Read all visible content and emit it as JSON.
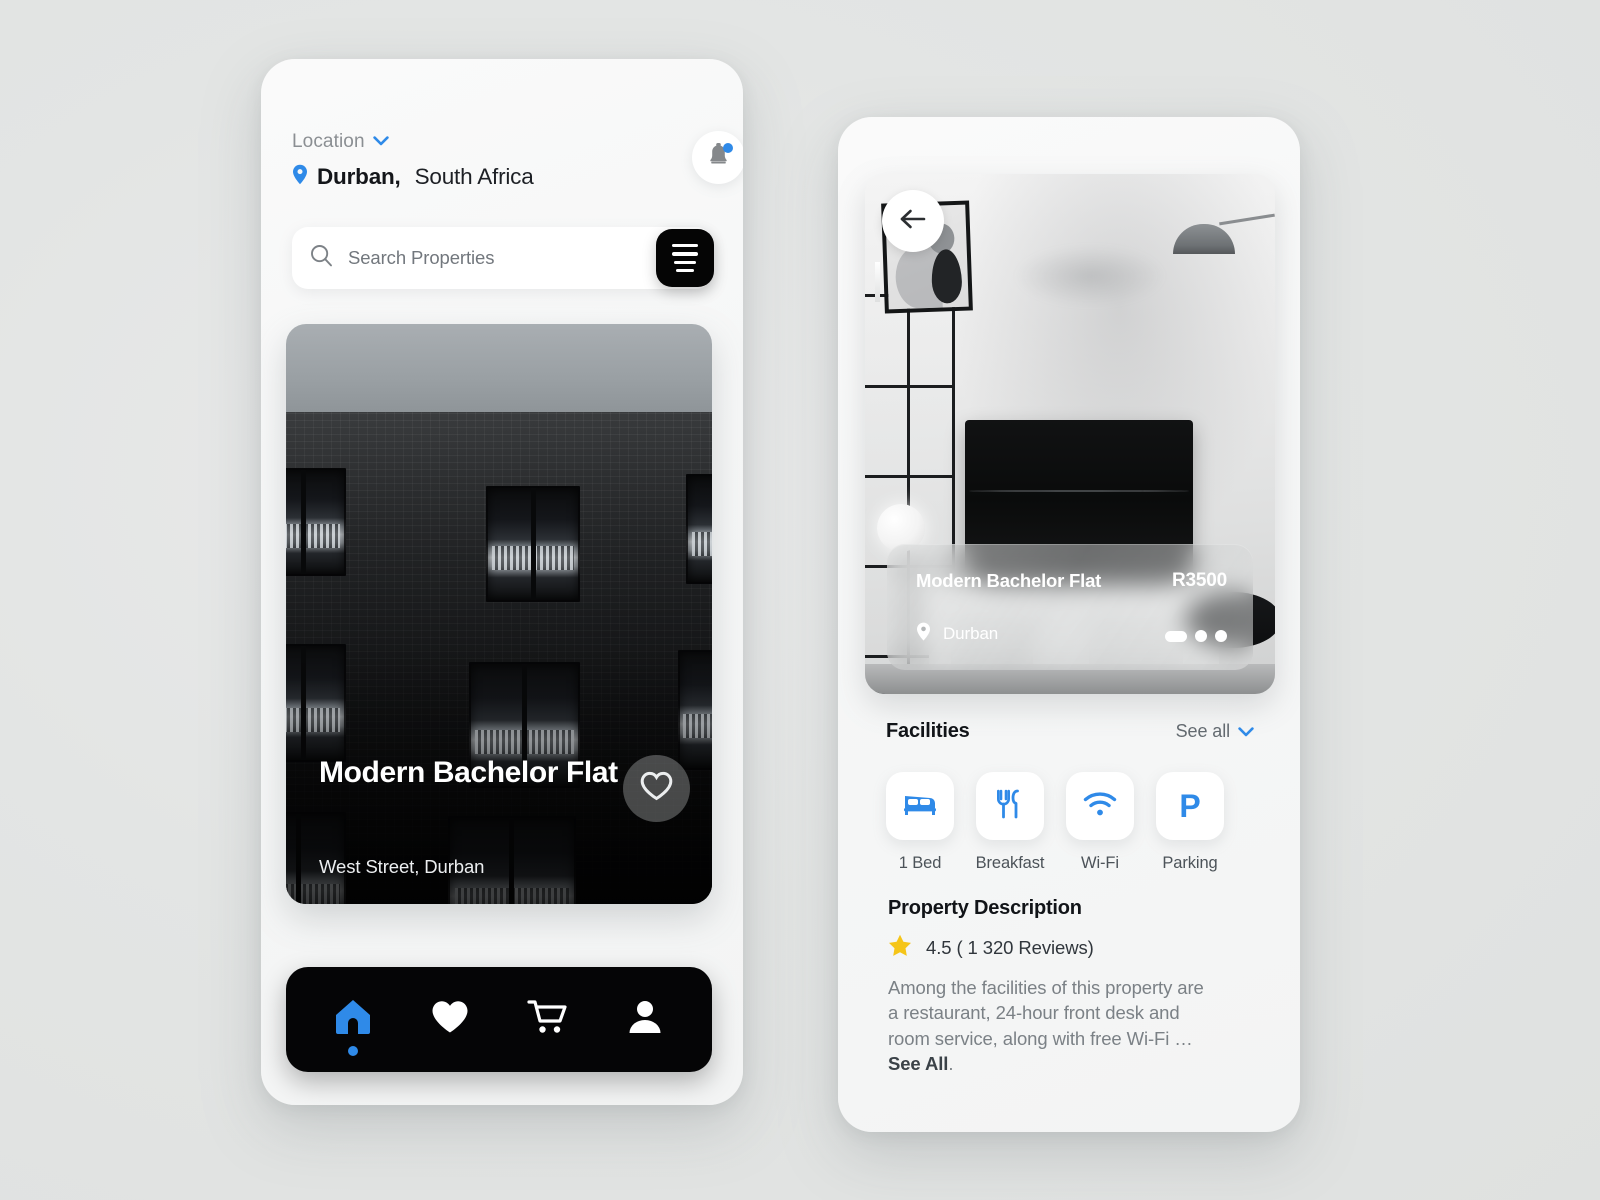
{
  "theme": {
    "accent_blue": "#2f8ae8",
    "dark": "#050506",
    "page_bg": "#e3e5e4",
    "star_yellow": "#f5c518"
  },
  "home_screen": {
    "location": {
      "label": "Location",
      "chevron_icon": "chevron-down-icon",
      "pin_icon": "map-pin-icon",
      "city": "Durban,",
      "country": "South Africa"
    },
    "notification": {
      "icon": "bell-icon",
      "has_unread": true
    },
    "search": {
      "icon": "search-icon",
      "placeholder": "Search Properties",
      "value": "",
      "filter_icon": "filter-lines-icon"
    },
    "property_card": {
      "title": "Modern Bachelor Flat",
      "address": "West Street, Durban",
      "favorite_icon": "heart-outline-icon",
      "image_alt": "dark brick apartment building facade"
    },
    "bottom_nav": [
      {
        "name": "home",
        "icon": "home-icon",
        "active": true
      },
      {
        "name": "favorites",
        "icon": "heart-icon",
        "active": false
      },
      {
        "name": "cart",
        "icon": "cart-icon",
        "active": false
      },
      {
        "name": "profile",
        "icon": "user-icon",
        "active": false
      }
    ]
  },
  "detail_screen": {
    "back_icon": "arrow-left-icon",
    "hero_image_alt": "living room with large curved tv and black shelving",
    "overlay_card": {
      "title": "Modern Bachelor Flat",
      "price": "R3500",
      "pin_icon": "map-pin-icon",
      "location": "Durban",
      "pagination": {
        "total": 3,
        "active_index": 0
      }
    },
    "facilities": {
      "title": "Facilities",
      "see_all_label": "See all",
      "see_all_chevron": "chevron-down-icon",
      "items": [
        {
          "label": "1 Bed",
          "icon": "bed-icon"
        },
        {
          "label": "Breakfast",
          "icon": "cutlery-icon"
        },
        {
          "label": "Wi-Fi",
          "icon": "wifi-icon"
        },
        {
          "label": "Parking",
          "icon": "parking-p-icon"
        }
      ]
    },
    "description": {
      "title": "Property Description",
      "star_icon": "star-icon",
      "rating_text": "4.5 ( 1 320 Reviews)",
      "body_prefix": "Among the facilities of this property are a restaurant, 24-hour front desk and room service, along with free Wi-Fi … ",
      "body_link": "See All",
      "body_suffix": "."
    }
  }
}
